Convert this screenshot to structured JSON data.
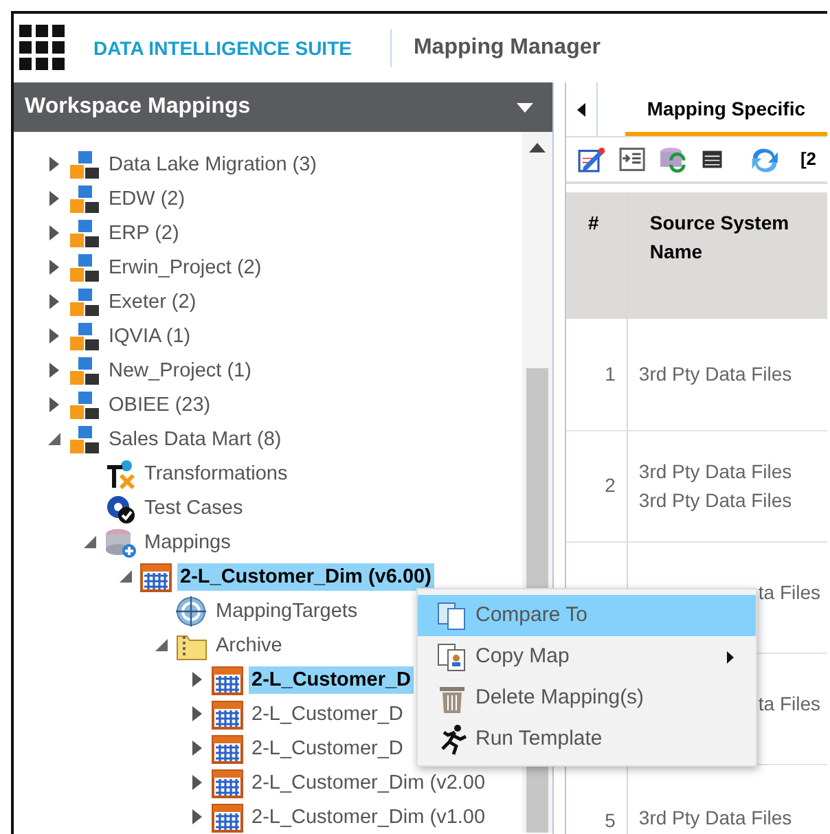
{
  "header": {
    "brand": "DATA INTELLIGENCE SUITE",
    "title": "Mapping Manager"
  },
  "left_panel": {
    "title": "Workspace Mappings",
    "tree": [
      {
        "kind": "project",
        "label": "Data Lake Migration (3)",
        "expanded": false,
        "selected": false
      },
      {
        "kind": "project",
        "label": "EDW (2)",
        "expanded": false,
        "selected": false
      },
      {
        "kind": "project",
        "label": "ERP (2)",
        "expanded": false,
        "selected": false
      },
      {
        "kind": "project",
        "label": "Erwin_Project (2)",
        "expanded": false,
        "selected": false
      },
      {
        "kind": "project",
        "label": "Exeter (2)",
        "expanded": false,
        "selected": false
      },
      {
        "kind": "project",
        "label": "IQVIA (1)",
        "expanded": false,
        "selected": false
      },
      {
        "kind": "project",
        "label": "New_Project (1)",
        "expanded": false,
        "selected": false
      },
      {
        "kind": "project",
        "label": "OBIEE (23)",
        "expanded": false,
        "selected": false
      },
      {
        "kind": "project",
        "label": "Sales Data Mart (8)",
        "expanded": true,
        "selected": false,
        "children": [
          {
            "kind": "transformations",
            "label": "Transformations",
            "selected": false
          },
          {
            "kind": "test-cases",
            "label": "Test Cases",
            "selected": false
          },
          {
            "kind": "mappings",
            "label": "Mappings",
            "expanded": true,
            "selected": false,
            "children": [
              {
                "kind": "mapping",
                "label": "2-L_Customer_Dim (v6.00)",
                "expanded": true,
                "selected": true,
                "children": [
                  {
                    "kind": "targets",
                    "label": "MappingTargets",
                    "selected": false
                  },
                  {
                    "kind": "archive",
                    "label": "Archive",
                    "expanded": true,
                    "selected": false,
                    "children": [
                      {
                        "kind": "mapping",
                        "label": "2-L_Customer_D",
                        "expanded": false,
                        "selected": true
                      },
                      {
                        "kind": "mapping",
                        "label": "2-L_Customer_D",
                        "expanded": false,
                        "selected": false
                      },
                      {
                        "kind": "mapping",
                        "label": "2-L_Customer_D",
                        "expanded": false,
                        "selected": false
                      },
                      {
                        "kind": "mapping",
                        "label": "2-L_Customer_Dim (v2.00",
                        "expanded": false,
                        "selected": false
                      },
                      {
                        "kind": "mapping",
                        "label": "2-L_Customer_Dim (v1.00",
                        "expanded": false,
                        "selected": false
                      }
                    ]
                  }
                ]
              }
            ]
          }
        ]
      }
    ]
  },
  "right_panel": {
    "tab": {
      "label": "Mapping Specific",
      "selected": true
    },
    "toolbar": {
      "text": "[2"
    },
    "table": {
      "columns": [
        "#",
        "Source System Name"
      ],
      "rows": [
        {
          "number": "1",
          "source": [
            "3rd Pty Data Files"
          ]
        },
        {
          "number": "2",
          "source": [
            "3rd Pty Data Files",
            "3rd Pty Data Files"
          ]
        },
        {
          "source": [
            "ta Files"
          ]
        },
        {
          "source": [
            "ta Files"
          ]
        },
        {
          "number": "5",
          "source": [
            "3rd Pty Data Files"
          ]
        }
      ]
    }
  },
  "context_menu": [
    {
      "label": "Compare To",
      "selected": true,
      "submenu": false
    },
    {
      "label": "Copy Map",
      "selected": false,
      "submenu": true
    },
    {
      "label": "Delete Mapping(s)",
      "selected": false,
      "submenu": false
    },
    {
      "label": "Run Template",
      "selected": false,
      "submenu": false
    }
  ]
}
